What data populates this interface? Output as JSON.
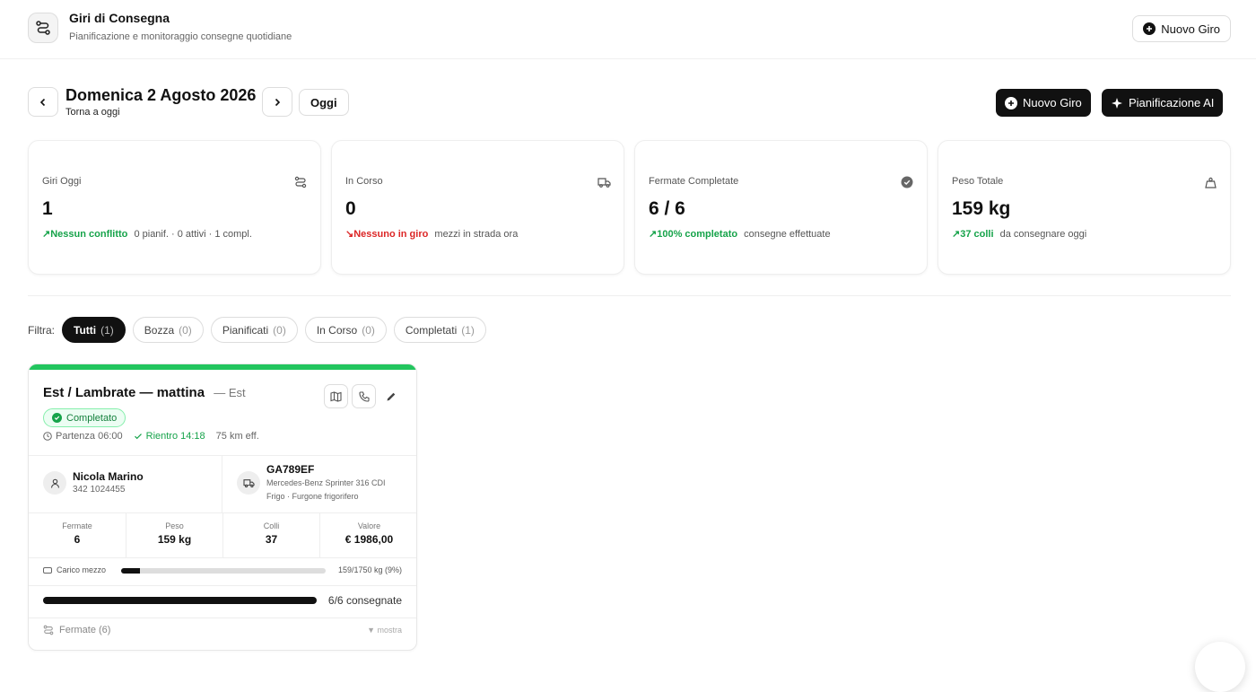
{
  "header": {
    "title": "Giri di Consegna",
    "subtitle": "Pianificazione e monitoraggio consegne quotidiane",
    "new_button": "Nuovo Giro"
  },
  "date_nav": {
    "date": "Domenica 2 Agosto 2026",
    "back_to_today": "Torna a oggi",
    "today_button": "Oggi"
  },
  "actions": {
    "new_tour": "Nuovo Giro",
    "ai_planning": "Pianificazione AI"
  },
  "kpis": [
    {
      "label": "Giri Oggi",
      "value": "1",
      "trend": "↗Nessun conflitto",
      "note": "0 pianif. · 0 attivi · 1 compl.",
      "icon": "route-icon"
    },
    {
      "label": "In Corso",
      "value": "0",
      "trend": "↘Nessuno in giro",
      "note": "mezzi in strada ora",
      "icon": "truck-icon"
    },
    {
      "label": "Fermate Completate",
      "value": "6 / 6",
      "trend": "↗100% completato",
      "note": "consegne effettuate",
      "icon": "check-circle-icon"
    },
    {
      "label": "Peso Totale",
      "value": "159 kg",
      "trend": "↗37 colli",
      "note": "da consegnare oggi",
      "icon": "weight-icon"
    }
  ],
  "filters": {
    "label": "Filtra:",
    "chips": [
      {
        "label": "Tutti",
        "count": "(1)",
        "active": true
      },
      {
        "label": "Bozza",
        "count": "(0)"
      },
      {
        "label": "Pianificati",
        "count": "(0)"
      },
      {
        "label": "In Corso",
        "count": "(0)"
      },
      {
        "label": "Completati",
        "count": "(1)"
      }
    ]
  },
  "tour_card": {
    "title": "Est / Lambrate — mattina",
    "zone": "— Est",
    "status": "Completato",
    "departure": "Partenza 06:00",
    "return": "Rientro 14:18",
    "distance": "75 km eff.",
    "driver": {
      "name": "Nicola Marino",
      "phone": "342 1024455"
    },
    "vehicle": {
      "plate": "GA789EF",
      "model": "Mercedes-Benz Sprinter 316 CDI",
      "type": "Frigo · Furgone frigorifero"
    },
    "stats": [
      {
        "label": "Fermate",
        "value": "6"
      },
      {
        "label": "Peso",
        "value": "159 kg"
      },
      {
        "label": "Colli",
        "value": "37"
      },
      {
        "label": "Valore",
        "value": "€ 1986,00"
      }
    ],
    "load_label": "Carico mezzo",
    "load_value": "159/1750 kg (9%)",
    "load_fraction": 0.09,
    "progress_label": "6/6 consegnate",
    "progress_fraction": 1.0,
    "stops_label": "Fermate (6)",
    "stops_toggle": "▼ mostra",
    "accent": "#22c55e"
  }
}
